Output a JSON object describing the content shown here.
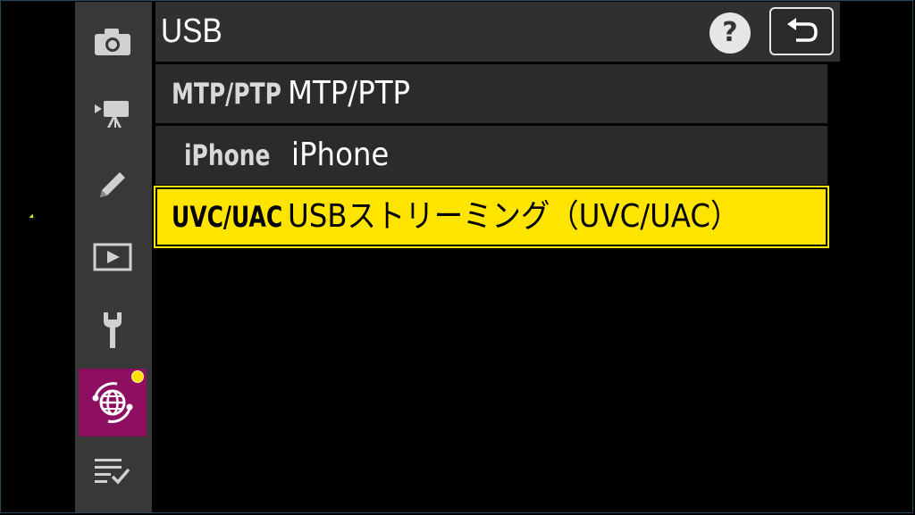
{
  "header": {
    "title": "USB",
    "help_label": "?",
    "back_icon": "return-arrow-icon"
  },
  "sidebar": {
    "items": [
      {
        "icon": "camera-icon"
      },
      {
        "icon": "movie-camera-icon"
      },
      {
        "icon": "pencil-icon"
      },
      {
        "icon": "playback-icon"
      },
      {
        "icon": "wrench-icon"
      },
      {
        "icon": "network-globe-icon",
        "active": true,
        "badge": true
      },
      {
        "icon": "checklist-icon"
      }
    ]
  },
  "options": [
    {
      "key": "MTP/PTP",
      "value": "MTP/PTP"
    },
    {
      "key": "iPhone",
      "value": "iPhone"
    },
    {
      "key": "UVC/UAC",
      "value": "USBストリーミング（UVC/UAC）",
      "selected": true
    }
  ],
  "colors": {
    "selection": "#ffe400",
    "active_tab": "#8e0f62",
    "sidebar": "#383838",
    "row": "#2b2b2b"
  }
}
